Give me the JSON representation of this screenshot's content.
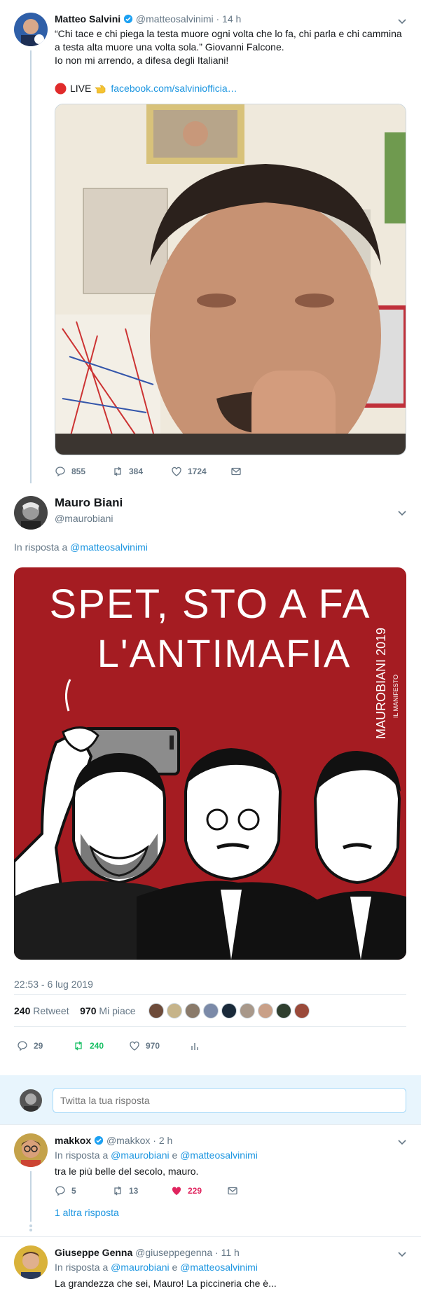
{
  "tweet1": {
    "name": "Matteo Salvini",
    "handle": "@matteosalvinimi",
    "time": "· 14 h",
    "text_line1": "“Chi tace e chi piega la testa muore ogni volta che lo fa, chi parla e chi cammina",
    "text_line2": "a testa alta muore una volta sola.” Giovanni Falcone.",
    "text_line3": "Io non mi arrendo, a difesa degli Italiani!",
    "live_label": "LIVE",
    "live_link": "facebook.com/salviniofficia…",
    "replies": "855",
    "retweets": "384",
    "likes": "1724",
    "icons": [
      "red-circle-icon",
      "pointing-hand-icon",
      "reply-icon",
      "retweet-icon",
      "like-icon",
      "message-icon"
    ]
  },
  "main_tweet": {
    "name": "Mauro Biani",
    "handle": "@maurobiani",
    "in_reply_prefix": "In risposta a",
    "in_reply_handle": "@matteosalvinimi",
    "cartoon_line1": "SPET, STO A FA",
    "cartoon_line2": "L'ANTIMAFIA",
    "cartoon_signature": "MAUROBIANI 2019",
    "cartoon_signature2": "IL MANIFESTO",
    "timestamp": "22:53 - 6 lug 2019",
    "retweet_count": "240",
    "retweet_label": "Retweet",
    "like_count": "970",
    "like_label": "Mi piace",
    "replies": "29",
    "retweets": "240",
    "likes": "970",
    "accent_color": "#17bf63",
    "cartoon_bg": "#a51c22"
  },
  "composer": {
    "placeholder": "Twitta la tua risposta"
  },
  "reply1": {
    "name": "makkox",
    "handle": "@makkox",
    "time": "· 2 h",
    "in_reply_prefix": "In risposta a",
    "handle_a": "@maurobiani",
    "conj": "e",
    "handle_b": "@matteosalvinimi",
    "text": "tra le più belle del secolo, mauro.",
    "replies": "5",
    "retweets": "13",
    "likes": "229",
    "like_color": "#e0245e",
    "more_replies": "1 altra risposta"
  },
  "reply2": {
    "name": "Giuseppe Genna",
    "handle": "@giuseppegenna",
    "time": "· 11 h",
    "in_reply_prefix": "In risposta a",
    "handle_a": "@maurobiani",
    "conj": "e",
    "handle_b": "@matteosalvinimi",
    "text": "La grandezza che sei, Mauro! La piccineria che è..."
  }
}
